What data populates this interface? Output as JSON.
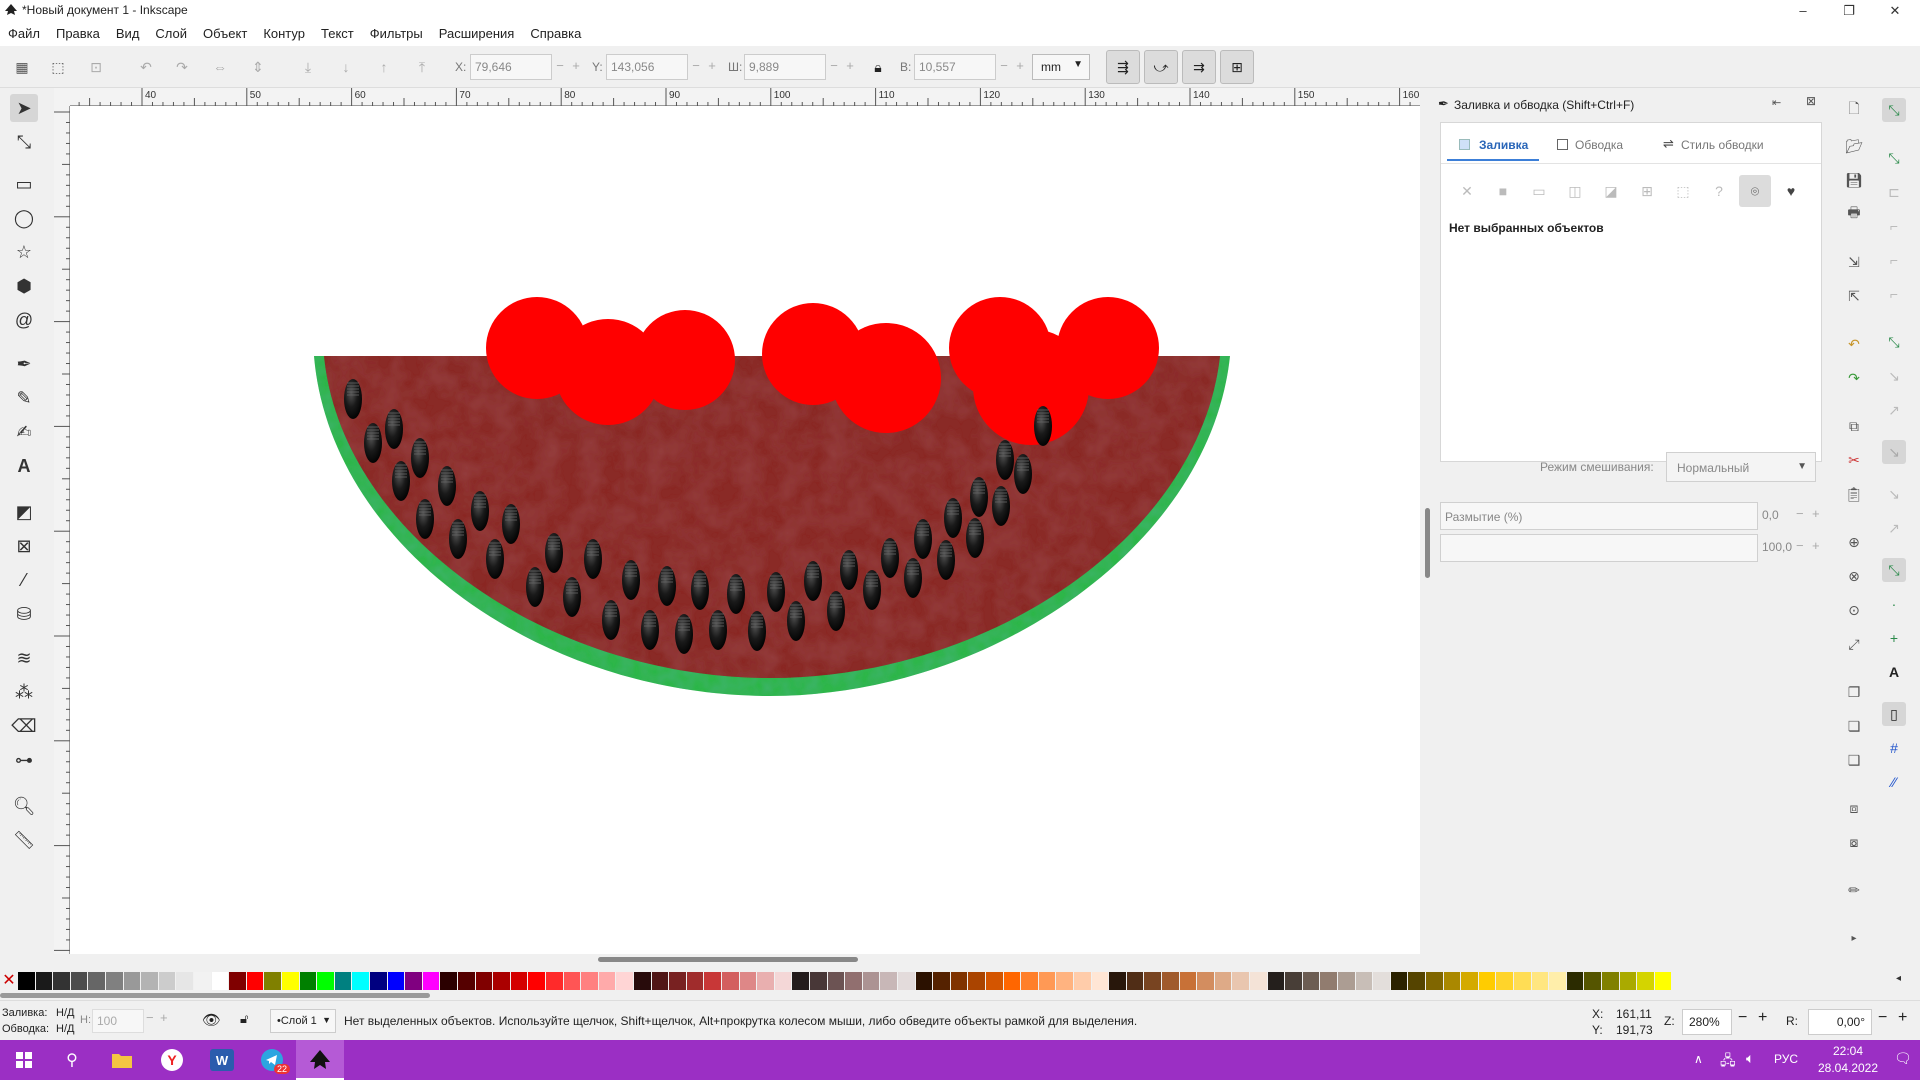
{
  "window": {
    "title": "*Новый документ 1 - Inkscape",
    "minimize": "–",
    "maximize": "❐",
    "close": "✕"
  },
  "menu": [
    "Файл",
    "Правка",
    "Вид",
    "Слой",
    "Объект",
    "Контур",
    "Текст",
    "Фильтры",
    "Расширения",
    "Справка"
  ],
  "controls": {
    "x_label": "X:",
    "x_value": "79,646",
    "y_label": "Y:",
    "y_value": "143,056",
    "w_label": "Ш:",
    "w_value": "9,889",
    "h_label": "В:",
    "h_value": "10,557",
    "unit": "mm"
  },
  "ruler_labels": [
    "40",
    "50",
    "60",
    "70",
    "80",
    "90",
    "100",
    "110",
    "120",
    "130",
    "140",
    "150",
    "160"
  ],
  "dialog": {
    "title": "Заливка и обводка (Shift+Ctrl+F)",
    "tabs": [
      "Заливка",
      "Обводка",
      "Стиль обводки"
    ],
    "paint_icons": [
      "✕",
      "■",
      "▭",
      "◫",
      "◪",
      "⊞",
      "⬚",
      "?",
      "⌾",
      "♥"
    ],
    "no_selection": "Нет выбранных объектов",
    "blend_label": "Режим смешивания:",
    "blend_value": "Нормальный",
    "blur_label": "Размытие (%)",
    "blur_value": "0,0",
    "opacity_value": "100,0"
  },
  "status": {
    "fill_label": "Заливка:",
    "fill_value": "Н/Д",
    "stroke_label": "Обводка:",
    "stroke_value": "Н/Д",
    "opacity_label": "Н:",
    "opacity_value": "100",
    "layer": "•Слой 1",
    "message": "Нет выделенных объектов. Используйте щелчок, Shift+щелчок, Alt+прокрутка колесом мыши, либо обведите объекты рамкой для выделения.",
    "cursor_x_label": "X:",
    "cursor_x": "161,11",
    "cursor_y_label": "Y:",
    "cursor_y": "191,73",
    "zoom_label": "Z:",
    "zoom": "280%",
    "rotate_label": "R:",
    "rotate": "0,00°"
  },
  "taskbar": {
    "time": "22:04",
    "date": "28.04.2022",
    "lang": "РУС",
    "telegram_badge": "22"
  },
  "colors": {
    "taskbar": "#9b2fc4",
    "rind": "#2fb64a",
    "flesh": "#8a2a26",
    "cherry": "#ff0000",
    "seed": "#111111"
  }
}
